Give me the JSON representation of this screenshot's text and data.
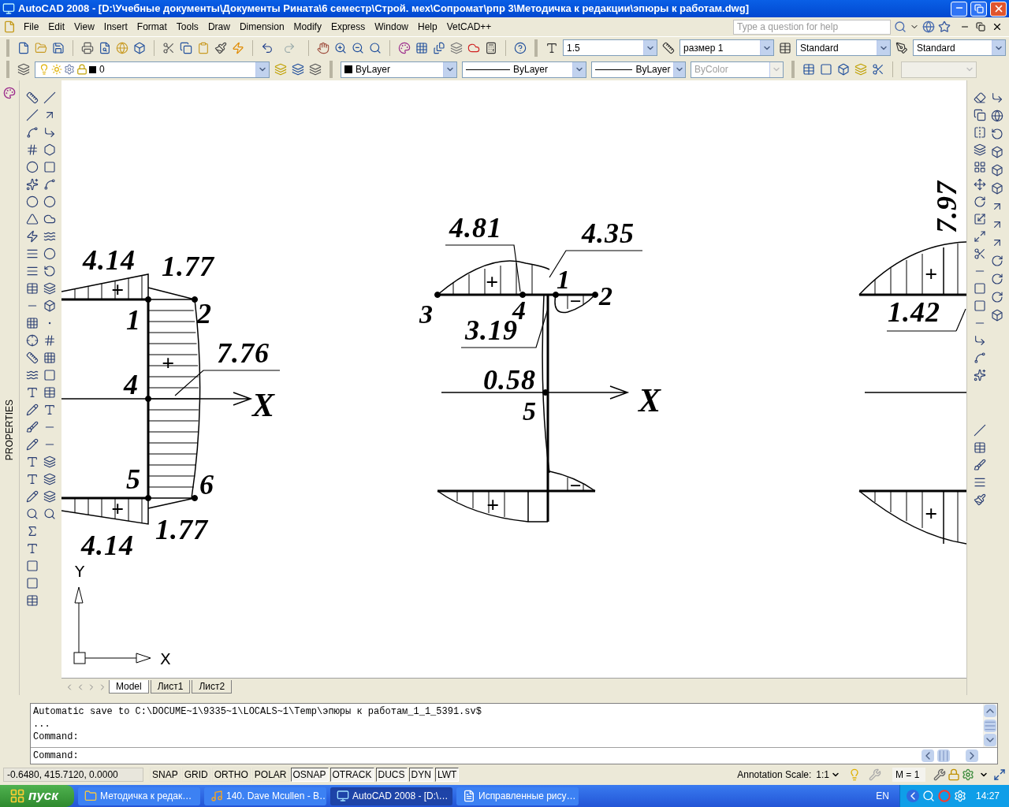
{
  "window": {
    "title": "AutoCAD 2008 - [D:\\Учебные документы\\Документы Рината\\6 семестр\\Строй. мех\\Сопромат\\рпр 3\\Методичка к редакции\\эпюры к работам.dwg]"
  },
  "menu": [
    "File",
    "Edit",
    "View",
    "Insert",
    "Format",
    "Tools",
    "Draw",
    "Dimension",
    "Modify",
    "Express",
    "Window",
    "Help",
    "VetCAD++"
  ],
  "help_search": {
    "placeholder": "Type a question for help"
  },
  "style_fields": [
    {
      "kind": "text_style",
      "value": "1.5"
    },
    {
      "kind": "dim_style",
      "value": "размер 1"
    },
    {
      "kind": "table_style",
      "value": "Standard"
    },
    {
      "kind": "mleader_style",
      "value": "Standard"
    }
  ],
  "layer": {
    "value": "0"
  },
  "property_fields": [
    {
      "kind": "color",
      "value": "ByLayer",
      "disabled": false
    },
    {
      "kind": "linetype",
      "value": "ByLayer",
      "disabled": false
    },
    {
      "kind": "lineweight",
      "value": "ByLayer",
      "disabled": false
    },
    {
      "kind": "plotstyle",
      "value": "ByColor",
      "disabled": true
    }
  ],
  "side_panel": {
    "title": "PROPERTIES"
  },
  "drawing": {
    "labels": [
      "4.14",
      "1.77",
      "+",
      "1",
      "2",
      "+",
      "7.76",
      "4",
      "X",
      "5",
      "6",
      "+",
      "1.77",
      "4.14",
      "4.81",
      "4.35",
      "+",
      "1",
      "2",
      "3",
      "4",
      "−",
      "3.19",
      "0.58",
      "X",
      "5",
      "+",
      "−",
      "7.97",
      "+",
      "1.42",
      "+"
    ],
    "ucs": {
      "y_label": "Y",
      "x_label": "X"
    }
  },
  "layout_tabs": [
    {
      "label": "Model",
      "selected": true
    },
    {
      "label": "Лист1",
      "selected": false
    },
    {
      "label": "Лист2",
      "selected": false
    }
  ],
  "command_history": [
    "Automatic save to C:\\DOCUME~1\\9335~1\\LOCALS~1\\Temp\\эпюры к работам_1_1_5391.sv$",
    "...",
    "Command:"
  ],
  "command_line": {
    "prompt": "Command:"
  },
  "status_bar": {
    "coordinates": "-0.6480, 415.7120, 0.0000",
    "toggles": [
      {
        "label": "SNAP",
        "on": false
      },
      {
        "label": "GRID",
        "on": false
      },
      {
        "label": "ORTHO",
        "on": false
      },
      {
        "label": "POLAR",
        "on": false
      },
      {
        "label": "OSNAP",
        "on": true
      },
      {
        "label": "OTRACK",
        "on": true
      },
      {
        "label": "DUCS",
        "on": true
      },
      {
        "label": "DYN",
        "on": true
      },
      {
        "label": "LWT",
        "on": true
      }
    ],
    "annotation_label": "Annotation Scale:",
    "annotation_scale": "1:1",
    "model_scale": "M = 1"
  },
  "taskbar": {
    "start": "пуск",
    "tasks": [
      {
        "label": "Методичка к редак…",
        "kind": "folder",
        "selected": false
      },
      {
        "label": "140. Dave Mcullen - B…",
        "kind": "player",
        "selected": false
      },
      {
        "label": "AutoCAD 2008 - [D:\\…",
        "kind": "cad",
        "selected": true
      },
      {
        "label": "Исправленные рису…",
        "kind": "document",
        "selected": false
      }
    ],
    "language": "EN",
    "clock": "14:27"
  }
}
